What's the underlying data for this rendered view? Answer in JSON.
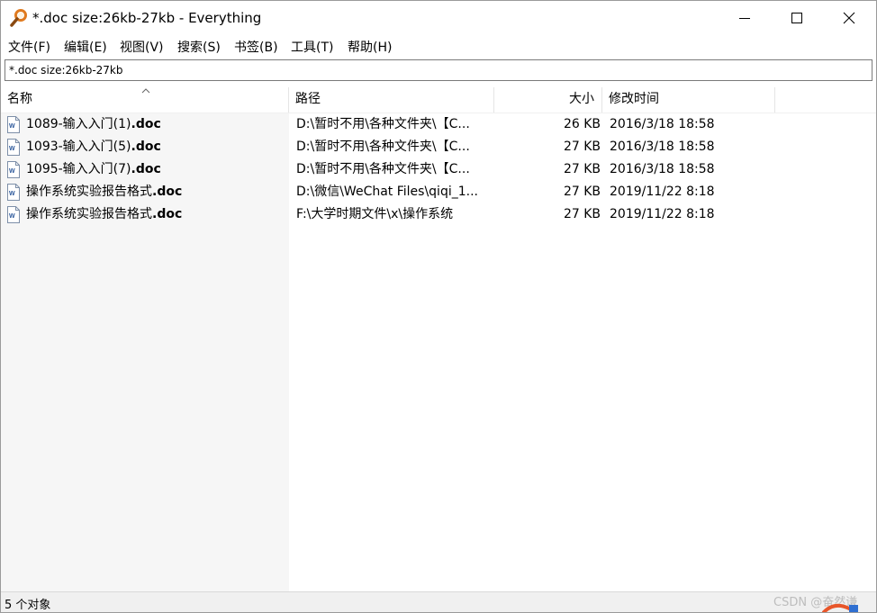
{
  "window": {
    "title": "*.doc size:26kb-27kb - Everything",
    "icon": "magnifier-icon",
    "controls": [
      "minimize-icon",
      "maximize-icon",
      "close-icon"
    ]
  },
  "menu": [
    "文件(F)",
    "编辑(E)",
    "视图(V)",
    "搜索(S)",
    "书签(B)",
    "工具(T)",
    "帮助(H)"
  ],
  "search": {
    "value": "*.doc size:26kb-27kb"
  },
  "columns": {
    "name": "名称",
    "path": "路径",
    "size": "大小",
    "modified": "修改时间"
  },
  "files": [
    {
      "base": "1089-输入入门(1)",
      "ext": ".doc",
      "path": "D:\\暂时不用\\各种文件夹\\【C...",
      "size": "26 KB",
      "modified": "2016/3/18 18:58"
    },
    {
      "base": "1093-输入入门(5)",
      "ext": ".doc",
      "path": "D:\\暂时不用\\各种文件夹\\【C...",
      "size": "27 KB",
      "modified": "2016/3/18 18:58"
    },
    {
      "base": "1095-输入入门(7)",
      "ext": ".doc",
      "path": "D:\\暂时不用\\各种文件夹\\【C...",
      "size": "27 KB",
      "modified": "2016/3/18 18:58"
    },
    {
      "base": "操作系统实验报告格式",
      "ext": ".doc",
      "path": "D:\\微信\\WeChat Files\\qiqi_1...",
      "size": "27 KB",
      "modified": "2019/11/22 8:18"
    },
    {
      "base": "操作系统实验报告格式",
      "ext": ".doc",
      "path": "F:\\大学时期文件\\x\\操作系统",
      "size": "27 KB",
      "modified": "2019/11/22 8:18"
    }
  ],
  "status": {
    "text": "5 个对象"
  },
  "watermark": "CSDN @奋然谦",
  "colors": {
    "accent": "#e07a1f",
    "word_icon": "#2b579a",
    "name_column_bg": "#f6f6f6",
    "statusbar_bg": "#f0f0f0"
  }
}
